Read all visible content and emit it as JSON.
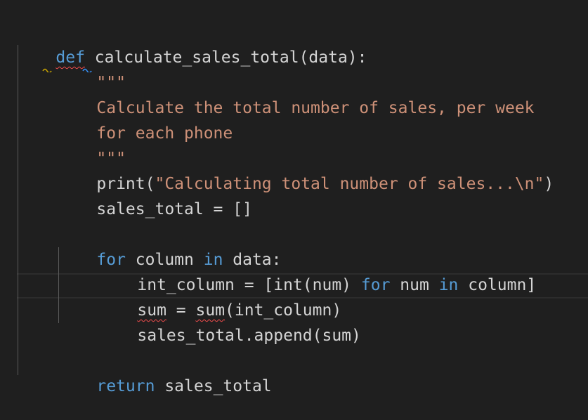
{
  "code": {
    "line1": {
      "kw": "def",
      "rest": " calculate_sales_total(data):"
    },
    "line2": {
      "text": "\"\"\""
    },
    "line3": {
      "text": "Calculate the total number of sales, per week"
    },
    "line4": {
      "text": "for each phone"
    },
    "line5": {
      "text": "\"\"\""
    },
    "line6": {
      "fn": "print(",
      "str": "\"Calculating total number of sales...\\n\"",
      "close": ")"
    },
    "line7": {
      "text": "sales_total = []"
    },
    "line9": {
      "kw_for": "for",
      "var": " column ",
      "kw_in": "in",
      "rest": " data:"
    },
    "line10": {
      "a": "int_column = [int(num) ",
      "kw_for": "for",
      "b": " num ",
      "kw_in": "in",
      "c": " column]"
    },
    "line11": {
      "sum1": "sum",
      "mid": " = ",
      "sum2": "sum",
      "rest": "(int_column)"
    },
    "line12": {
      "text": "sales_total.append(sum)"
    },
    "line14": {
      "kw": "return",
      "rest": " sales_total"
    }
  },
  "colors": {
    "background": "#1f1f1f",
    "keyword": "#569cd6",
    "string": "#ce9178",
    "text": "#d4d4d4",
    "error_squiggle": "#f14c4c",
    "warning_squiggle": "#cca700"
  },
  "icons": {
    "warning_hint": "wavy-warning-icon",
    "info_hint": "wavy-info-icon"
  }
}
